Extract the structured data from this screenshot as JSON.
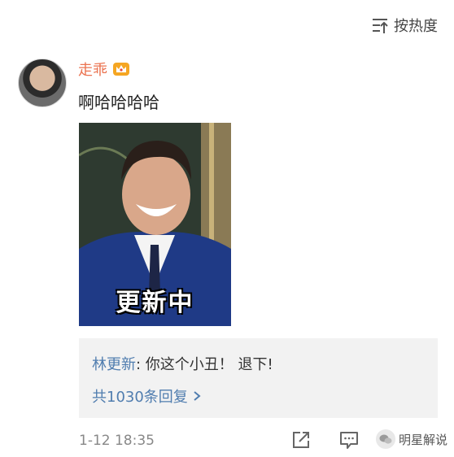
{
  "sort": {
    "label": "按热度",
    "icon": "sort-icon"
  },
  "comment": {
    "username": "走乖",
    "badge_icon": "vip-crown-icon",
    "text": "啊哈哈哈哈",
    "image_caption": "更新中",
    "reply_author": "林更新",
    "reply_text": ": 你这个小丑！ 退下!",
    "reply_count_label": "共1030条回复",
    "timestamp": "1-12 18:35",
    "username_color": "#eb7350",
    "link_color": "#507daf"
  },
  "watermark": {
    "text": "明星解说"
  }
}
